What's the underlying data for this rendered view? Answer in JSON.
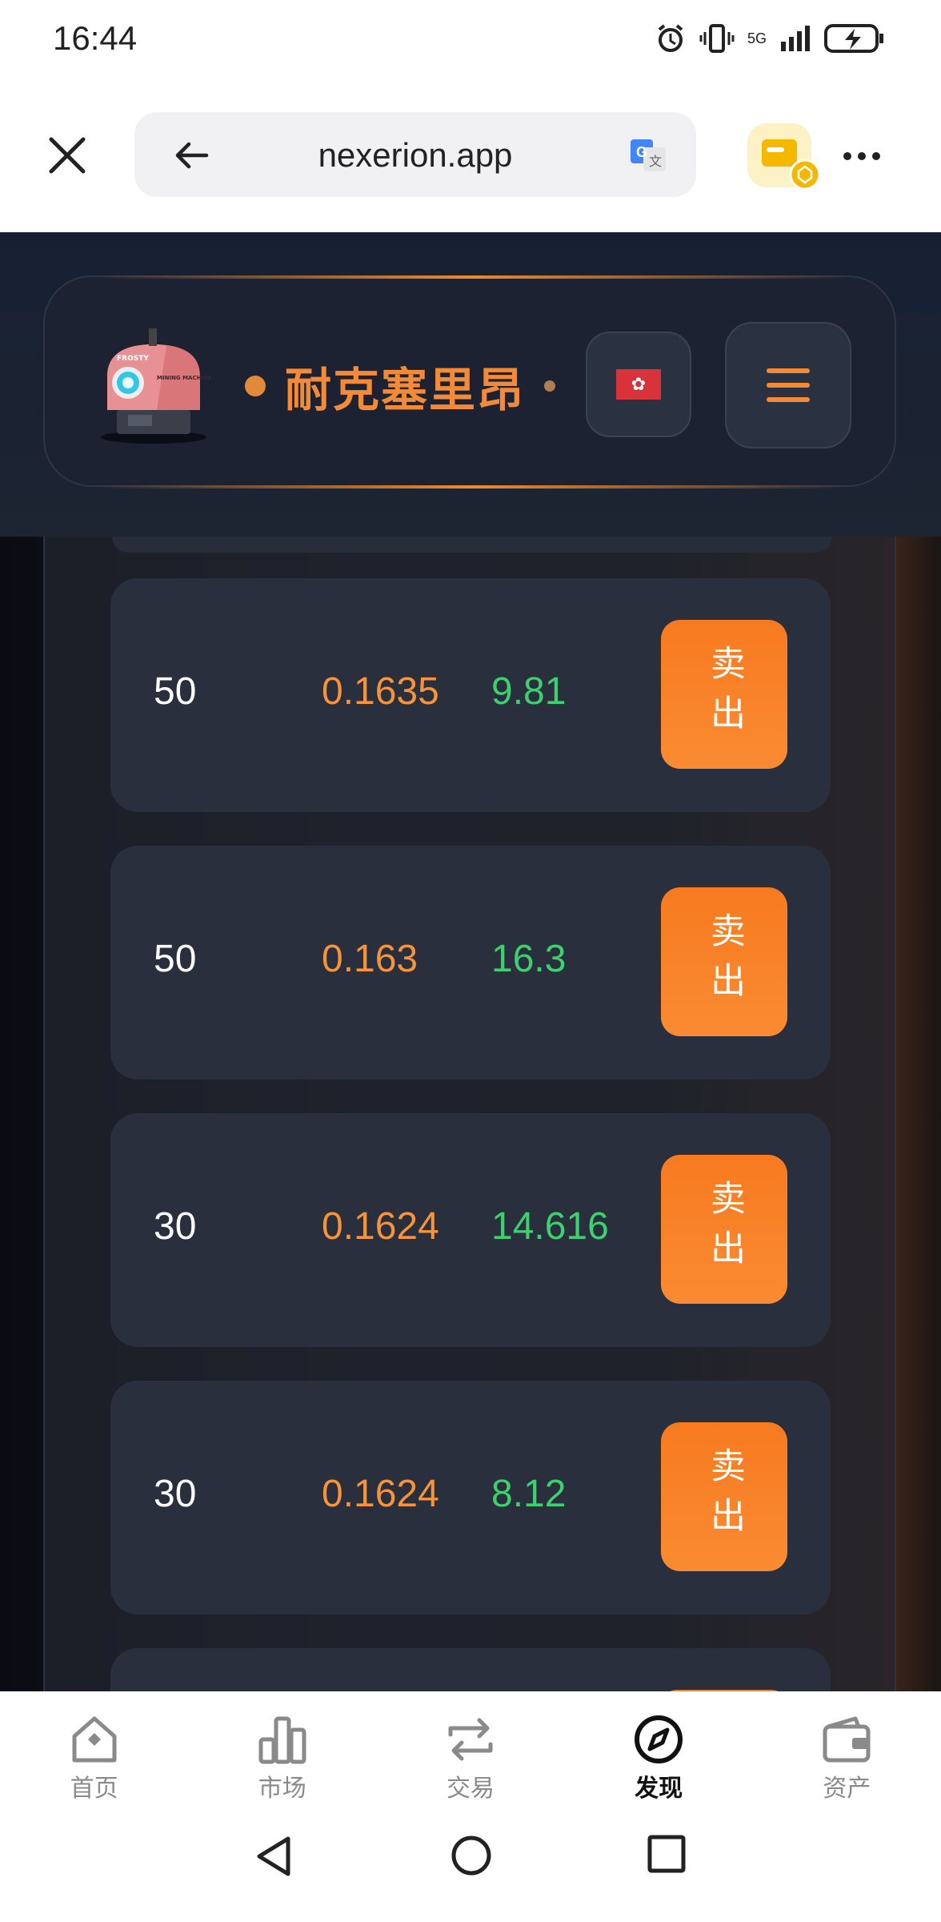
{
  "status_bar": {
    "time": "16:44",
    "network": "5G"
  },
  "browser": {
    "url": "nexerion.app"
  },
  "header": {
    "logo_text_1": "FROSTY",
    "logo_text_2": "MINING MACHINE",
    "brand_name": "耐克塞里昂",
    "language_flag": "Hong Kong flag",
    "accent_color": "#f28a38"
  },
  "orders": [
    {
      "quantity": "50",
      "price": "0.1635",
      "total": "9.81",
      "action": "卖出"
    },
    {
      "quantity": "50",
      "price": "0.163",
      "total": "16.3",
      "action": "卖出"
    },
    {
      "quantity": "30",
      "price": "0.1624",
      "total": "14.616",
      "action": "卖出"
    },
    {
      "quantity": "30",
      "price": "0.1624",
      "total": "8.12",
      "action": "卖出"
    }
  ],
  "bottom_nav": [
    {
      "label": "首页",
      "icon": "home-icon"
    },
    {
      "label": "市场",
      "icon": "bar-chart-icon"
    },
    {
      "label": "交易",
      "icon": "swap-icon"
    },
    {
      "label": "发现",
      "icon": "compass-icon",
      "active": true
    },
    {
      "label": "资产",
      "icon": "wallet-icon"
    }
  ]
}
